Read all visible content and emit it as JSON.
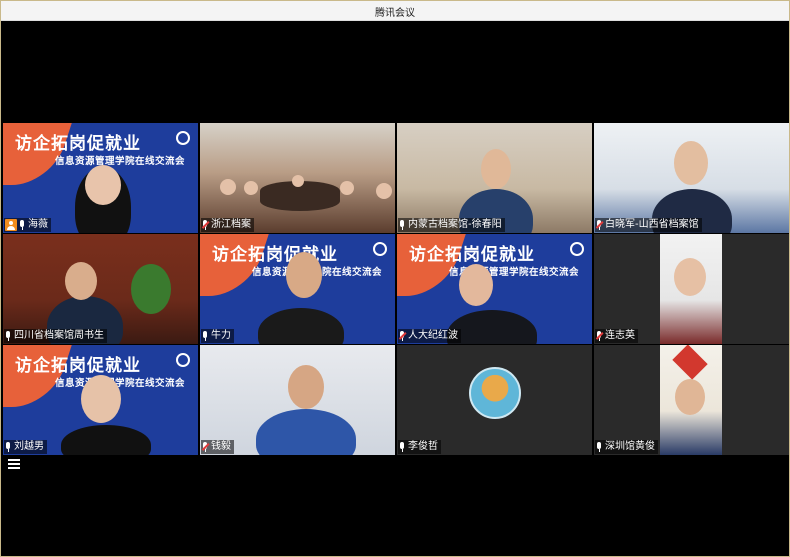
{
  "window": {
    "title": "腾讯会议"
  },
  "banner": {
    "line1": "访企拓岗促就业",
    "line2": "信息资源管理学院在线交流会"
  },
  "participants": [
    {
      "name": "海薇",
      "mic": "on",
      "host": true,
      "scene": "banner"
    },
    {
      "name": "浙江档案",
      "mic": "off",
      "host": false,
      "scene": "room"
    },
    {
      "name": "内蒙古档案馆-徐春阳",
      "mic": "on",
      "host": false,
      "scene": "shelf"
    },
    {
      "name": "白晓军-山西省档案馆",
      "mic": "off",
      "host": false,
      "scene": "office"
    },
    {
      "name": "四川省档案馆周书生",
      "mic": "on",
      "host": false,
      "scene": "library"
    },
    {
      "name": "牛力",
      "mic": "on",
      "host": false,
      "scene": "banner"
    },
    {
      "name": "人大纪红波",
      "mic": "off",
      "host": false,
      "scene": "banner"
    },
    {
      "name": "连志英",
      "mic": "off",
      "host": false,
      "scene": "portrait"
    },
    {
      "name": "刘越男",
      "mic": "on",
      "host": false,
      "scene": "banner"
    },
    {
      "name": "钱毅",
      "mic": "off",
      "host": false,
      "scene": "light"
    },
    {
      "name": "李俊哲",
      "mic": "on",
      "host": false,
      "scene": "avatar"
    },
    {
      "name": "深圳馆黄俊",
      "mic": "on",
      "host": false,
      "scene": "portrait"
    }
  ],
  "icons": {
    "menu": "menu-icon",
    "mic": "mic-icon",
    "mic_muted": "mic-muted-icon",
    "host": "host-icon"
  },
  "colors": {
    "banner_blue": "#1e3d9c",
    "banner_orange": "#e7613a",
    "host_orange": "#f08c1e",
    "muted_red": "#e23b3b"
  }
}
